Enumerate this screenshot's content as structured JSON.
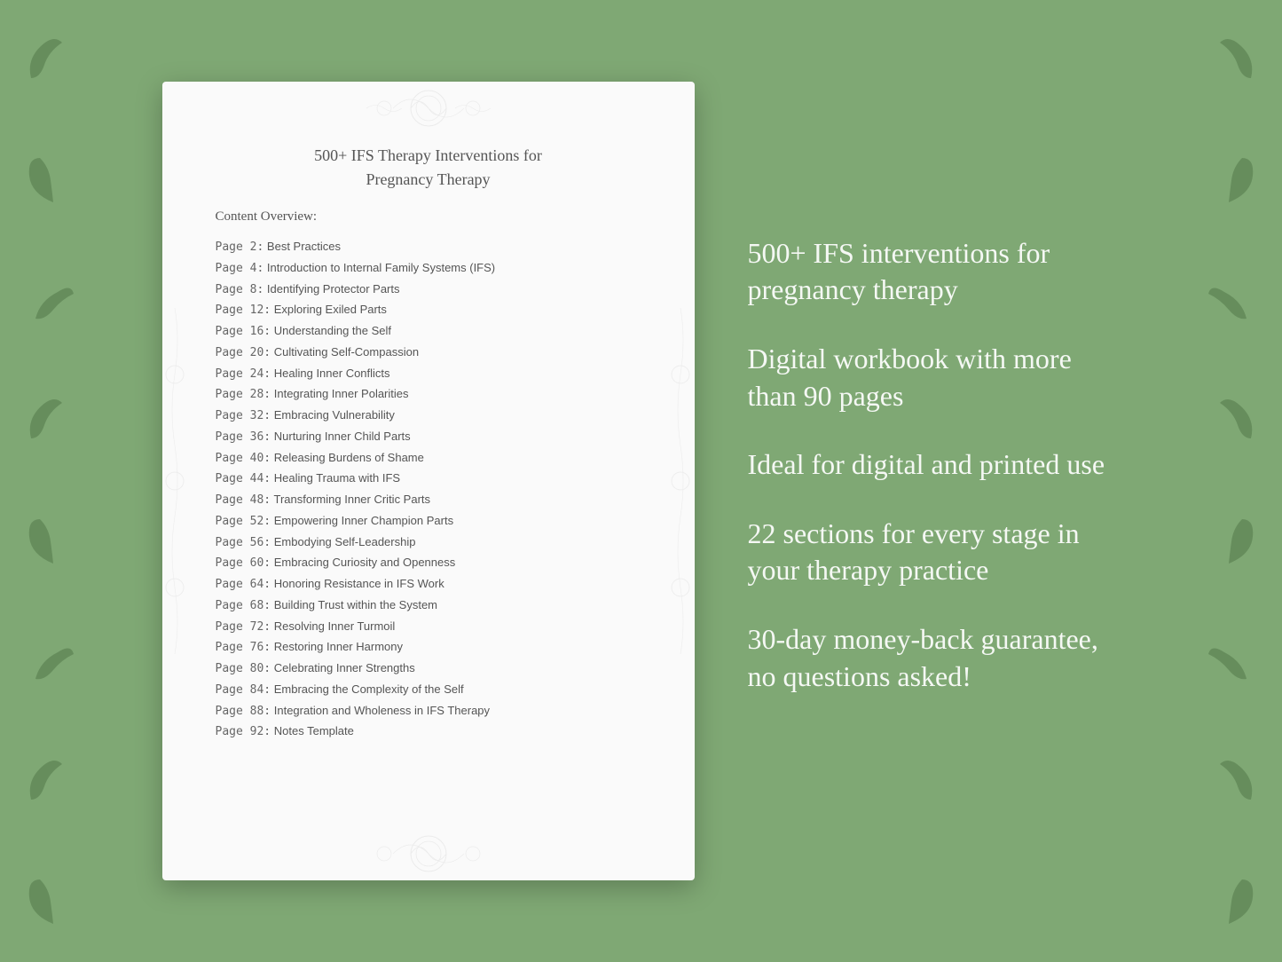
{
  "background": {
    "color": "#7fa874"
  },
  "document": {
    "title_line1": "500+ IFS Therapy Interventions for",
    "title_line2": "Pregnancy Therapy",
    "section_label": "Content Overview:",
    "toc_items": [
      {
        "page": "Page  2:",
        "title": "Best Practices"
      },
      {
        "page": "Page  4:",
        "title": "Introduction to Internal Family Systems (IFS)"
      },
      {
        "page": "Page  8:",
        "title": "Identifying Protector Parts"
      },
      {
        "page": "Page 12:",
        "title": "Exploring Exiled Parts"
      },
      {
        "page": "Page 16:",
        "title": "Understanding the Self"
      },
      {
        "page": "Page 20:",
        "title": "Cultivating Self-Compassion"
      },
      {
        "page": "Page 24:",
        "title": "Healing Inner Conflicts"
      },
      {
        "page": "Page 28:",
        "title": "Integrating Inner Polarities"
      },
      {
        "page": "Page 32:",
        "title": "Embracing Vulnerability"
      },
      {
        "page": "Page 36:",
        "title": "Nurturing Inner Child Parts"
      },
      {
        "page": "Page 40:",
        "title": "Releasing Burdens of Shame"
      },
      {
        "page": "Page 44:",
        "title": "Healing Trauma with IFS"
      },
      {
        "page": "Page 48:",
        "title": "Transforming Inner Critic Parts"
      },
      {
        "page": "Page 52:",
        "title": "Empowering Inner Champion Parts"
      },
      {
        "page": "Page 56:",
        "title": "Embodying Self-Leadership"
      },
      {
        "page": "Page 60:",
        "title": "Embracing Curiosity and Openness"
      },
      {
        "page": "Page 64:",
        "title": "Honoring Resistance in IFS Work"
      },
      {
        "page": "Page 68:",
        "title": "Building Trust within the System"
      },
      {
        "page": "Page 72:",
        "title": "Resolving Inner Turmoil"
      },
      {
        "page": "Page 76:",
        "title": "Restoring Inner Harmony"
      },
      {
        "page": "Page 80:",
        "title": "Celebrating Inner Strengths"
      },
      {
        "page": "Page 84:",
        "title": "Embracing the Complexity of the Self"
      },
      {
        "page": "Page 88:",
        "title": "Integration and Wholeness in IFS Therapy"
      },
      {
        "page": "Page 92:",
        "title": "Notes Template"
      }
    ]
  },
  "features": [
    "500+ IFS interventions for pregnancy therapy",
    "Digital workbook with more than 90 pages",
    "Ideal for digital and printed use",
    "22 sections for every stage in your therapy practice",
    "30-day money-back guarantee, no questions asked!"
  ]
}
